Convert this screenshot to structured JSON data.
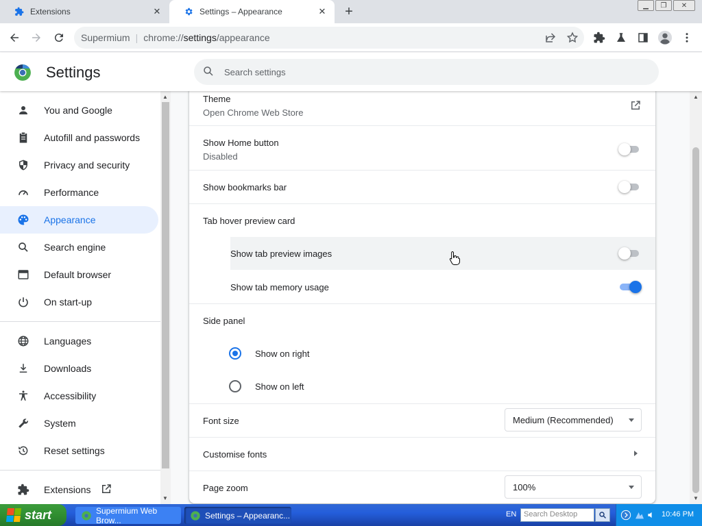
{
  "browser": {
    "tabs": [
      {
        "label": "Extensions",
        "active": false
      },
      {
        "label": "Settings – Appearance",
        "active": true
      }
    ],
    "omnibox": {
      "site_name": "Supermium",
      "url_scheme": "chrome://",
      "url_host": "settings",
      "url_path": "/appearance"
    }
  },
  "settings": {
    "title": "Settings",
    "search_placeholder": "Search settings"
  },
  "sidebar": {
    "items": [
      {
        "label": "You and Google",
        "icon": "person-icon",
        "selected": false
      },
      {
        "label": "Autofill and passwords",
        "icon": "clipboard-icon",
        "selected": false
      },
      {
        "label": "Privacy and security",
        "icon": "shield-icon",
        "selected": false
      },
      {
        "label": "Performance",
        "icon": "speedometer-icon",
        "selected": false
      },
      {
        "label": "Appearance",
        "icon": "palette-icon",
        "selected": true
      },
      {
        "label": "Search engine",
        "icon": "search-icon",
        "selected": false
      },
      {
        "label": "Default browser",
        "icon": "browser-window-icon",
        "selected": false
      },
      {
        "label": "On start-up",
        "icon": "power-icon",
        "selected": false
      }
    ],
    "items2": [
      {
        "label": "Languages",
        "icon": "globe-icon"
      },
      {
        "label": "Downloads",
        "icon": "download-icon"
      },
      {
        "label": "Accessibility",
        "icon": "accessibility-icon"
      },
      {
        "label": "System",
        "icon": "wrench-icon"
      },
      {
        "label": "Reset settings",
        "icon": "history-icon"
      }
    ],
    "extensions": {
      "label": "Extensions",
      "icon": "puzzle-icon"
    }
  },
  "appearance": {
    "theme": {
      "label": "Theme",
      "sub": "Open Chrome Web Store"
    },
    "home_button": {
      "label": "Show Home button",
      "sub": "Disabled",
      "on": false
    },
    "bookmarks_bar": {
      "label": "Show bookmarks bar",
      "on": false
    },
    "tab_hover": {
      "label": "Tab hover preview card"
    },
    "tab_preview_images": {
      "label": "Show tab preview images",
      "on": false
    },
    "tab_memory_usage": {
      "label": "Show tab memory usage",
      "on": true
    },
    "side_panel": {
      "label": "Side panel",
      "options": [
        "Show on right",
        "Show on left"
      ],
      "selected": "Show on right"
    },
    "font_size": {
      "label": "Font size",
      "value": "Medium (Recommended)"
    },
    "customise_fonts": {
      "label": "Customise fonts"
    },
    "page_zoom": {
      "label": "Page zoom",
      "value": "100%"
    }
  },
  "taskbar": {
    "start_label": "start",
    "items": [
      "Supermium Web Brow...",
      "Settings – Appearanc..."
    ],
    "language": "EN",
    "search_placeholder": "Search Desktop",
    "clock": "10:46 PM"
  },
  "colors": {
    "accent": "#1a73e8",
    "selected_bg": "#e8f0fe",
    "taskbar": "#245edb",
    "start": "#308e30"
  }
}
